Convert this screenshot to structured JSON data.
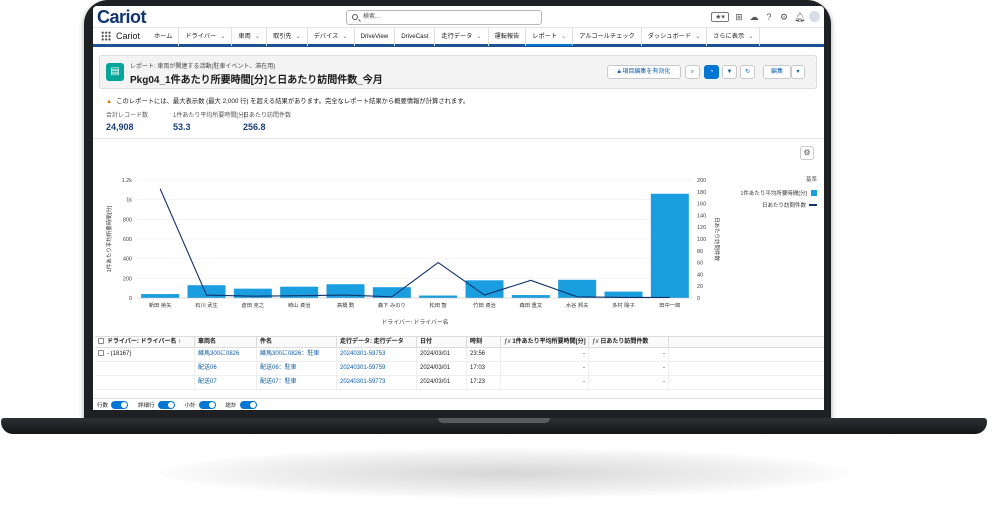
{
  "app": {
    "logo": "Cariot",
    "name": "Cariot"
  },
  "search": {
    "placeholder": "検索..."
  },
  "nav": [
    {
      "label": "ホーム",
      "chevron": false,
      "active": false
    },
    {
      "label": "ドライバー",
      "chevron": true,
      "active": false
    },
    {
      "label": "車両",
      "chevron": true,
      "active": false
    },
    {
      "label": "取引先",
      "chevron": true,
      "active": false
    },
    {
      "label": "デバイス",
      "chevron": true,
      "active": false
    },
    {
      "label": "DriveView",
      "chevron": false,
      "active": false
    },
    {
      "label": "DriveCast",
      "chevron": false,
      "active": false
    },
    {
      "label": "走行データ",
      "chevron": true,
      "active": false
    },
    {
      "label": "運転報告",
      "chevron": false,
      "active": false
    },
    {
      "label": "レポート",
      "chevron": true,
      "active": true
    },
    {
      "label": "アルコールチェック",
      "chevron": false,
      "active": false
    },
    {
      "label": "ダッシュボード",
      "chevron": true,
      "active": false
    },
    {
      "label": "さらに表示",
      "chevron": true,
      "active": false
    }
  ],
  "report": {
    "type": "レポート: 車両が関連する活動(駐車イベント、滞在用)",
    "title": "Pkg04_1件あたり所要時間[分]と日あたり訪問件数_今月",
    "btn_enable": "項目編集を有効化",
    "btn_edit": "編集",
    "warning": "このレポートには、最大表示数 (最大 2,000 行) を超える結果があります。完全なレポート結果から概要情報が計算されます。",
    "stats": [
      {
        "label": "合計レコード数",
        "value": "24,908"
      },
      {
        "label": "1件あたり平均所要時間[分]",
        "value": "53.3"
      },
      {
        "label": "日あたり訪問件数",
        "value": "256.8"
      }
    ]
  },
  "chart_data": {
    "type": "bar",
    "categories": [
      "新田 英矢",
      "石川 武生",
      "倉田 克之",
      "崎山 貞治",
      "高橋 勲",
      "森下 みのり",
      "松田 智",
      "竹田 貞治",
      "森田 重文",
      "水谷 邦夫",
      "多村 陽子",
      "田中一郎"
    ],
    "series": [
      {
        "name": "1件あたり平均所要時間[分]",
        "type": "bar",
        "axis": "left",
        "values": [
          40,
          130,
          95,
          115,
          140,
          110,
          25,
          180,
          30,
          185,
          65,
          1060
        ],
        "color": "#1a9ee0"
      },
      {
        "name": "日あたり訪問件数",
        "type": "line",
        "axis": "right",
        "values": [
          185,
          5,
          3,
          4,
          5,
          2,
          60,
          5,
          30,
          2,
          1,
          1
        ],
        "color": "#10336b"
      }
    ],
    "xlabel": "ドライバー: ドライバー名",
    "ylabel": "1件あたり平均所要時間[分]",
    "y2label": "日あたり訪問件数",
    "yticks": [
      "0",
      "200",
      "400",
      "600",
      "800",
      "1k",
      "1.2k"
    ],
    "ylim": [
      0,
      1200
    ],
    "y2ticks": [
      "0",
      "20",
      "40",
      "60",
      "80",
      "100",
      "120",
      "140",
      "160",
      "180",
      "200"
    ],
    "y2lim": [
      0,
      200
    ],
    "legend_title": "基準",
    "legend_position": "top-right"
  },
  "table": {
    "headers": [
      "ドライバー: ドライバー名 ↑",
      "車両名",
      "件名",
      "走行データ: 走行データ",
      "日付",
      "時刻",
      "1件あたり平均所要時間[分]",
      "日あたり訪問件数"
    ],
    "group": "- (18167)",
    "rows": [
      [
        "練馬300に0826",
        "練馬300に0826：駐車",
        "20240301-59753",
        "2024/03/01",
        "23:56",
        "-",
        "-"
      ],
      [
        "配送06",
        "配送06：駐車",
        "20240301-59759",
        "2024/03/01",
        "17:03",
        "-",
        "-"
      ],
      [
        "配送07",
        "配送07：駐車",
        "20240301-59773",
        "2024/03/01",
        "17:23",
        "-",
        "-"
      ]
    ]
  },
  "footer": [
    "行数",
    "詳細行",
    "小計",
    "総計"
  ]
}
